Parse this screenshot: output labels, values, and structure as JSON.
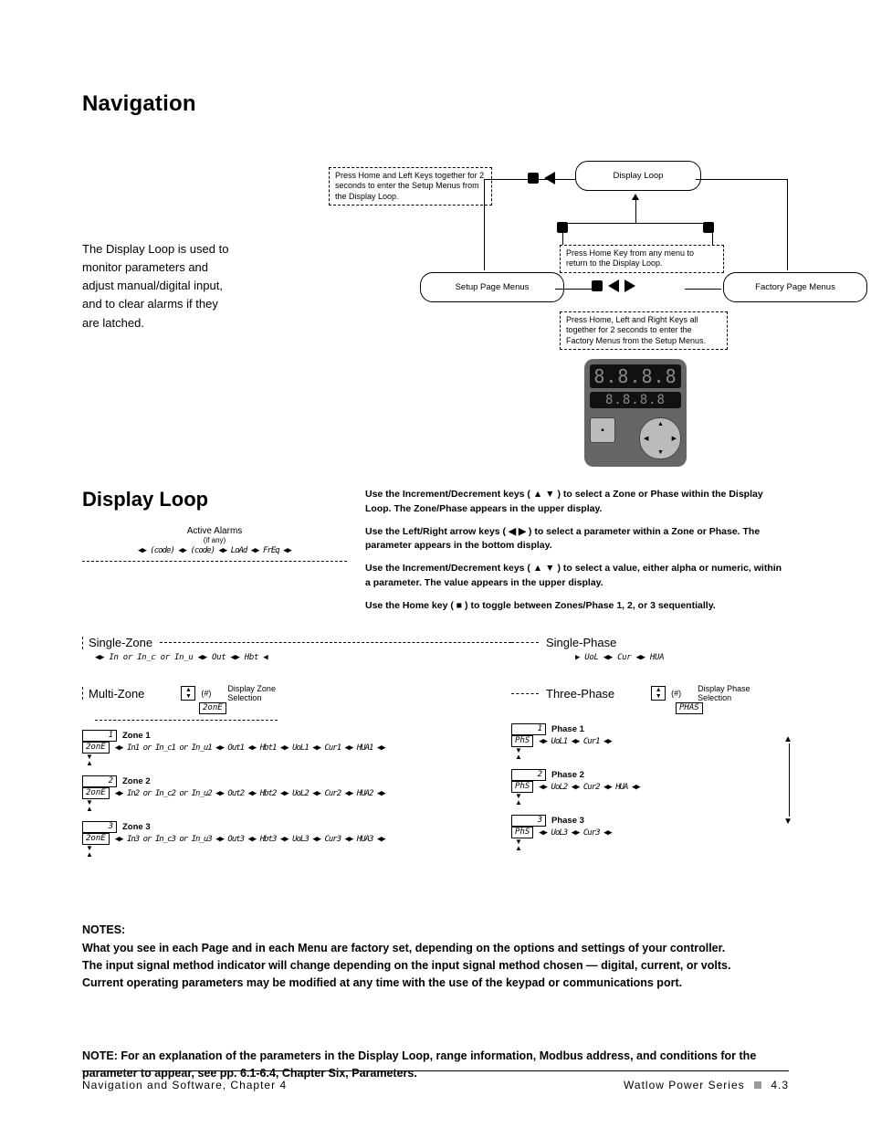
{
  "headings": {
    "navigation": "Navigation",
    "displayLoop": "Display Loop"
  },
  "intro": "The Display Loop is used to monitor parameters and adjust manual/digital input, and to clear alarms if they are latched.",
  "topDiagram": {
    "note1": "Press Home and Left Keys together for 2 seconds to enter the Setup Menus from the Display Loop.",
    "note2": "Press Home Key from any menu to return to the Display Loop.",
    "note3": "Press Home, Left and Right Keys all together for 2 seconds to enter the Factory Menus from the Setup Menus.",
    "box_displayLoop": "Display Loop",
    "box_setup": "Setup Page Menus",
    "box_factory": "Factory Page Menus",
    "device_top": "8.8.8.8",
    "device_bottom": "8.8.8.8"
  },
  "instructions": [
    "Use the Increment/Decrement keys ( ▲ ▼ ) to select a Zone or Phase within the Display Loop. The Zone/Phase appears in the upper display.",
    "Use the Left/Right arrow keys ( ◀  ▶ ) to select a parameter within a Zone or Phase. The parameter appears in the bottom display.",
    "Use the Increment/Decrement keys ( ▲ ▼ ) to select a value, either alpha or numeric, within a parameter. The value appears in the upper display.",
    "Use the Home key ( ■ ) to toggle between Zones/Phase 1, 2, or 3 sequentially."
  ],
  "activeAlarms": {
    "title": "Active Alarms",
    "subtitle": "(if any)",
    "row": "◀▶ (code) ◀▶ (code) ◀▶ LoAd ◀▶ FrEq ◀▶"
  },
  "lower": {
    "singleZone": "Single-Zone",
    "singlePhase": "Single-Phase",
    "multiZone": "Multi-Zone",
    "threePhase": "Three-Phase",
    "displayZoneSel": "Display Zone\nSelection",
    "displayPhaseSel": "Display Phase\nSelection",
    "zone_seg": "2onE",
    "phase_seg": "PHAS",
    "phs_seg": "PhS",
    "sz_row": "◀▶ In   or  In_c or  In_u  ◀▶ Out ◀▶ Hbt ◀",
    "sp_row": "▶ UoL ◀▶ Cur ◀▶ HUA",
    "zones": [
      {
        "num": "1",
        "seg": "1",
        "label": "Zone 1",
        "row": "◀▶ In1  or  In_c1 or  In_u1 ◀▶ Out1 ◀▶ Hbt1 ◀▶ UoL1 ◀▶ Cur1 ◀▶ HUA1 ◀▶"
      },
      {
        "num": "2",
        "seg": "2",
        "label": "Zone 2",
        "row": "◀▶ In2  or  In_c2 or  In_u2 ◀▶ Out2 ◀▶ Hbt2 ◀▶ UoL2 ◀▶ Cur2 ◀▶ HUA2 ◀▶"
      },
      {
        "num": "3",
        "seg": "3",
        "label": "Zone 3",
        "row": "◀▶ In3  or  In_c3 or  In_u3 ◀▶ Out3 ◀▶ Hbt3 ◀▶ UoL3 ◀▶ Cur3 ◀▶ HUA3 ◀▶"
      }
    ],
    "phases": [
      {
        "num": "1",
        "seg": "1",
        "label": "Phase 1",
        "row": "◀▶ UoL1 ◀▶ Cur1 ◀▶"
      },
      {
        "num": "2",
        "seg": "2",
        "label": "Phase 2",
        "row": "◀▶ UoL2 ◀▶ Cur2 ◀▶  HUA ◀▶"
      },
      {
        "num": "3",
        "seg": "3",
        "label": "Phase 3",
        "row": "◀▶ UoL3 ◀▶ Cur3 ◀▶"
      }
    ]
  },
  "notes": {
    "heading": "NOTES:",
    "lines": [
      "What you see in each Page and in each Menu are factory set, depending on the options and settings of your controller.",
      "The input signal method indicator will change depending on the input signal method chosen — digital, current, or volts.",
      "Current operating parameters may be modified at any time with the use of the keypad or communications port."
    ],
    "bottom": "NOTE: For an explanation of the parameters in the Display Loop, range information, Modbus address, and conditions for the parameter to appear, see pp. 6.1-6.4, Chapter Six, Parameters."
  },
  "footer": {
    "left": "Navigation and Software, Chapter 4",
    "right": "Watlow Power Series",
    "pg": "4.3"
  }
}
